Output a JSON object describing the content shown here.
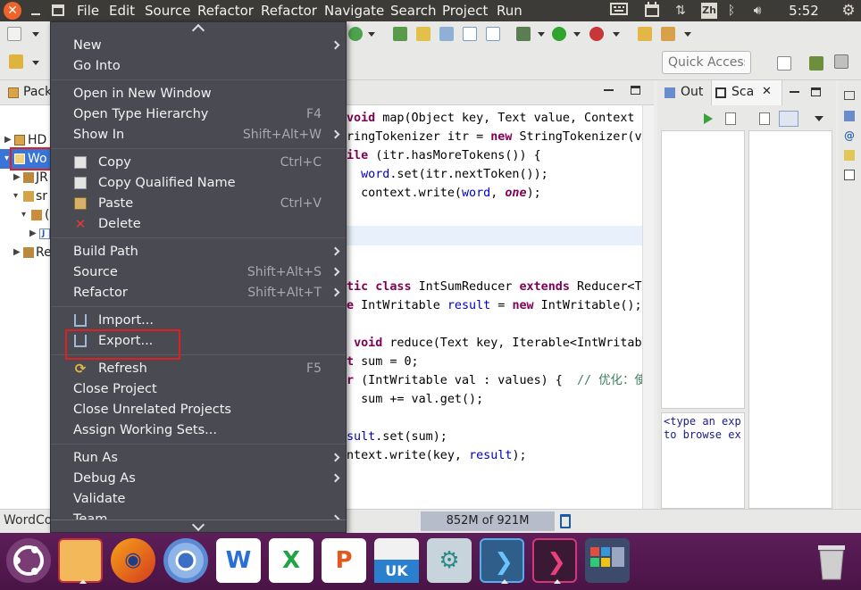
{
  "top_panel": {
    "menus": [
      "File",
      "Edit",
      "Source",
      "Refactor",
      "Refactor",
      "Navigate",
      "Search",
      "Project",
      "Run"
    ],
    "input_method": "Zh",
    "clock": "5:52 AM"
  },
  "toolbar": {
    "quick_access_placeholder": "Quick Access"
  },
  "package_explorer": {
    "tab_label": "Pack",
    "rows": [
      {
        "label": "HD"
      },
      {
        "label": "Wo"
      },
      {
        "label": "JR"
      },
      {
        "label": "sr"
      },
      {
        "label": "("
      },
      {
        "label": "J"
      },
      {
        "label": "Re"
      }
    ]
  },
  "editor": {
    "lines": [
      {
        "html": "<span class='kw'>void</span> map(Object key, Text value, Context"
      },
      {
        "html": "ringTokenizer itr = <span class='kw'>new</span> StringTokenizer(va"
      },
      {
        "html": "<span class='kw'>ile</span> (itr.hasMoreTokens()) {"
      },
      {
        "html": "  <span class='fld'>word</span>.set(itr.nextToken());"
      },
      {
        "html": "  context.write(<span class='fld'>word</span>, <span class='lit'>one</span>);"
      },
      {
        "html": ""
      },
      {
        "html": ""
      },
      {
        "html": ""
      },
      {
        "html": ""
      },
      {
        "html": "<span class='kw'>tic class</span> IntSumReducer <span class='kw'>extends</span> Reducer&lt;Te"
      },
      {
        "html": "<span class='kw'>e</span> IntWritable <span class='fld'>result</span> = <span class='kw'>new</span> IntWritable();"
      },
      {
        "html": ""
      },
      {
        "html": " <span class='kw'>void</span> reduce(Text key, Iterable&lt;IntWritabl"
      },
      {
        "html": "<span class='kw'>t</span> sum = 0;"
      },
      {
        "html": "<span class='kw'>r</span> (IntWritable val : values) {  <span class='cmt'>// 优化：使</span>"
      },
      {
        "html": "  sum += val.get();"
      },
      {
        "html": ""
      },
      {
        "html": "<span class='fld'>sult</span>.set(sum);"
      },
      {
        "html": "ntext.write(key, <span class='fld'>result</span>);"
      }
    ]
  },
  "right_panel": {
    "tab_outline": "Out",
    "tab_scala": "Sca",
    "hint": "<type an exp\nto browse ex"
  },
  "status": {
    "left": "WordCo",
    "heap": "852M of 921M"
  },
  "context_menu": {
    "items": [
      {
        "label": "New",
        "shortcut": "",
        "submenu": true,
        "icon": ""
      },
      {
        "label": "Go Into",
        "shortcut": "",
        "submenu": false,
        "icon": ""
      },
      {
        "sep": true
      },
      {
        "label": "Open in New Window",
        "shortcut": "",
        "submenu": false,
        "icon": ""
      },
      {
        "label": "Open Type Hierarchy",
        "shortcut": "F4",
        "submenu": false,
        "icon": ""
      },
      {
        "label": "Show In",
        "shortcut": "Shift+Alt+W",
        "submenu": true,
        "icon": ""
      },
      {
        "sep": true
      },
      {
        "label": "Copy",
        "shortcut": "Ctrl+C",
        "submenu": false,
        "icon": "copy-icon"
      },
      {
        "label": "Copy Qualified Name",
        "shortcut": "",
        "submenu": false,
        "icon": "copy-qualified-icon"
      },
      {
        "label": "Paste",
        "shortcut": "Ctrl+V",
        "submenu": false,
        "icon": "paste-icon"
      },
      {
        "label": "Delete",
        "shortcut": "",
        "submenu": false,
        "icon": "delete-icon"
      },
      {
        "sep": true
      },
      {
        "label": "Build Path",
        "shortcut": "",
        "submenu": true,
        "icon": ""
      },
      {
        "label": "Source",
        "shortcut": "Shift+Alt+S",
        "submenu": true,
        "icon": ""
      },
      {
        "label": "Refactor",
        "shortcut": "Shift+Alt+T",
        "submenu": true,
        "icon": ""
      },
      {
        "sep": true
      },
      {
        "label": "Import...",
        "shortcut": "",
        "submenu": false,
        "icon": "import-icon"
      },
      {
        "label": "Export...",
        "shortcut": "",
        "submenu": false,
        "icon": "export-icon"
      },
      {
        "sep": true
      },
      {
        "label": "Refresh",
        "shortcut": "F5",
        "submenu": false,
        "icon": "refresh-icon"
      },
      {
        "label": "Close Project",
        "shortcut": "",
        "submenu": false,
        "icon": ""
      },
      {
        "label": "Close Unrelated Projects",
        "shortcut": "",
        "submenu": false,
        "icon": ""
      },
      {
        "label": "Assign Working Sets...",
        "shortcut": "",
        "submenu": false,
        "icon": ""
      },
      {
        "sep": true
      },
      {
        "label": "Run As",
        "shortcut": "",
        "submenu": true,
        "icon": ""
      },
      {
        "label": "Debug As",
        "shortcut": "",
        "submenu": true,
        "icon": ""
      },
      {
        "label": "Validate",
        "shortcut": "",
        "submenu": false,
        "icon": ""
      },
      {
        "label": "Team",
        "shortcut": "",
        "submenu": true,
        "icon": ""
      }
    ]
  },
  "dock": {
    "items": [
      {
        "name": "ubuntu-dash-icon"
      },
      {
        "name": "files-icon"
      },
      {
        "name": "firefox-icon"
      },
      {
        "name": "chromium-icon"
      },
      {
        "name": "writer-icon"
      },
      {
        "name": "calc-icon"
      },
      {
        "name": "impress-icon"
      },
      {
        "name": "software-center-icon"
      },
      {
        "name": "system-settings-icon"
      },
      {
        "name": "terminal-blue-icon"
      },
      {
        "name": "terminal-magenta-icon"
      },
      {
        "name": "workspace-switcher-icon"
      },
      {
        "name": "trash-icon"
      }
    ]
  },
  "colors": {
    "accent_highlight": "#e02020",
    "menu_bg": "#4a4a52",
    "dock_bg": "#5d1e59",
    "selection": "#3875d7"
  }
}
